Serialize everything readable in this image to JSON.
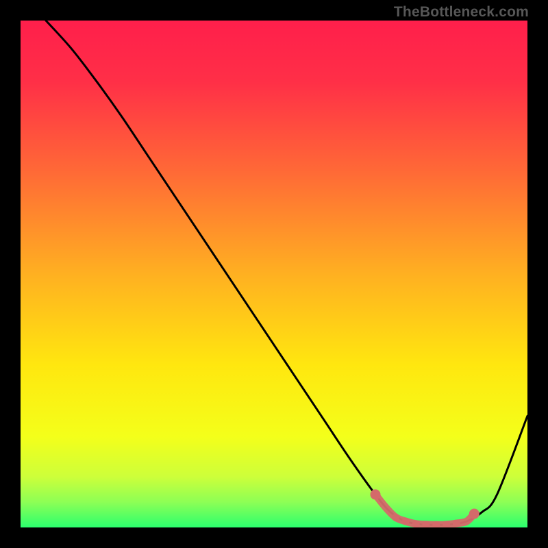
{
  "watermark": "TheBottleneck.com",
  "chart_data": {
    "type": "line",
    "title": "",
    "xlabel": "",
    "ylabel": "",
    "xlim": [
      0,
      100
    ],
    "ylim": [
      0,
      100
    ],
    "gradient_stops": [
      {
        "offset": 0.0,
        "color": "#ff1f4b"
      },
      {
        "offset": 0.12,
        "color": "#ff2f47"
      },
      {
        "offset": 0.3,
        "color": "#ff6a36"
      },
      {
        "offset": 0.5,
        "color": "#ffb021"
      },
      {
        "offset": 0.68,
        "color": "#ffe70f"
      },
      {
        "offset": 0.82,
        "color": "#f4ff1a"
      },
      {
        "offset": 0.9,
        "color": "#cdff3a"
      },
      {
        "offset": 0.95,
        "color": "#8dff55"
      },
      {
        "offset": 1.0,
        "color": "#2bff6e"
      }
    ],
    "series": [
      {
        "name": "bottleneck-curve",
        "x": [
          5,
          10,
          15,
          20,
          25,
          30,
          35,
          40,
          45,
          50,
          55,
          60,
          65,
          70,
          73,
          76,
          79,
          82,
          85,
          88,
          91,
          94,
          100
        ],
        "y": [
          100,
          94.5,
          88,
          81,
          73.5,
          66,
          58.5,
          51,
          43.5,
          36,
          28.5,
          21,
          13.5,
          6.5,
          3.0,
          1.2,
          0.6,
          0.5,
          0.6,
          1.2,
          3.0,
          6.5,
          22
        ]
      }
    ],
    "highlight": {
      "name": "optimal-band",
      "color": "#d46a6a",
      "points": [
        {
          "x": 70,
          "y": 6.5
        },
        {
          "x": 72,
          "y": 4.0
        },
        {
          "x": 74,
          "y": 2.0
        },
        {
          "x": 76,
          "y": 1.2
        },
        {
          "x": 78,
          "y": 0.7
        },
        {
          "x": 80,
          "y": 0.55
        },
        {
          "x": 82,
          "y": 0.5
        },
        {
          "x": 84,
          "y": 0.55
        },
        {
          "x": 86,
          "y": 0.8
        },
        {
          "x": 88,
          "y": 1.2
        },
        {
          "x": 89.5,
          "y": 2.7
        }
      ]
    }
  }
}
